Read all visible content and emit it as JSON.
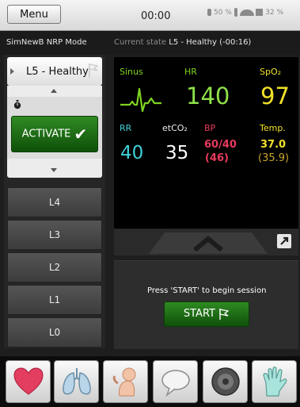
{
  "topbar": {
    "menu_label": "Menu",
    "time": "00:00",
    "battery_1": "50 %",
    "battery_2": "32 %"
  },
  "mode": {
    "name": "SimNewB NRP Mode",
    "current_state_prefix": "Current state",
    "current_state_value": "L5 - Healthy (-00:16)"
  },
  "scenario": {
    "selected": "L5 - Healthy",
    "activate_label": "ACTIVATE",
    "levels": [
      "L4",
      "L3",
      "L2",
      "L1",
      "L0"
    ]
  },
  "vitals": {
    "sinus_label": "Sinus",
    "hr_label": "HR",
    "hr": "140",
    "spo2_label": "SpO₂",
    "spo2": "97",
    "rr_label": "RR",
    "rr": "40",
    "etco2_label": "etCO₂",
    "etco2": "35",
    "bp_label": "BP",
    "bp": "60/40",
    "bp_mean": "(46)",
    "temp_label": "Temp.",
    "temp": "37.0",
    "temp_2": "(35.9)"
  },
  "session": {
    "message": "Press 'START' to begin session",
    "start_label": "START"
  },
  "dock": {
    "icons": [
      "heart-icon",
      "lungs-icon",
      "baby-icon",
      "speech-bubble-icon",
      "speaker-icon",
      "glove-icon"
    ]
  },
  "colors": {
    "accent_green": "#1f6e16",
    "hr_green": "#7ed321",
    "spo2_yellow": "#f0e12a",
    "rr_cyan": "#3fd0d6",
    "bp_red": "#e83a5c"
  }
}
